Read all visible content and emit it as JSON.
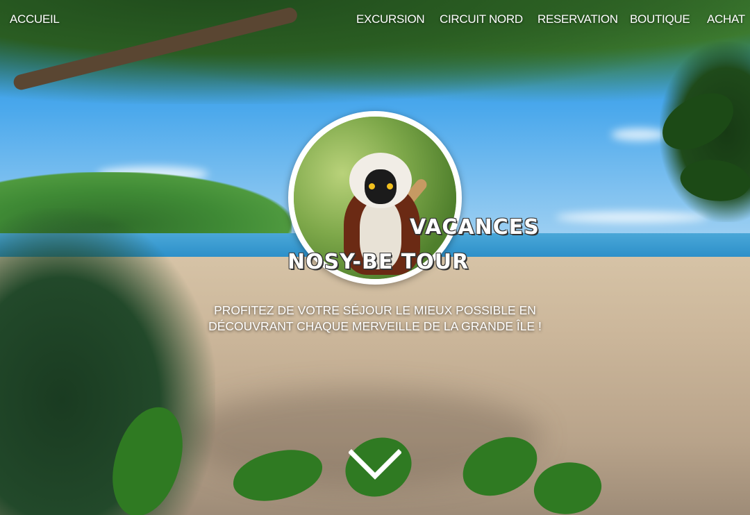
{
  "nav": {
    "home": "ACCUEIL",
    "items": [
      "EXCURSION",
      "CIRCUIT NORD",
      "RESERVATION",
      "BOUTIQUE",
      "ACHAT"
    ]
  },
  "hero": {
    "title_line1": "VACANCES",
    "title_line2": "NOSY-BE TOUR",
    "tagline": "PROFITEZ DE VOTRE SÉJOUR LE MIEUX POSSIBLE EN DÉCOUVRANT CHAQUE MERVEILLE DE LA GRANDE ÎLE !",
    "scroll_icon": "chevron-down-icon"
  },
  "colors": {
    "nav_text": "#ffffff",
    "title_text": "#ffffff",
    "title_outline": "#333333"
  }
}
